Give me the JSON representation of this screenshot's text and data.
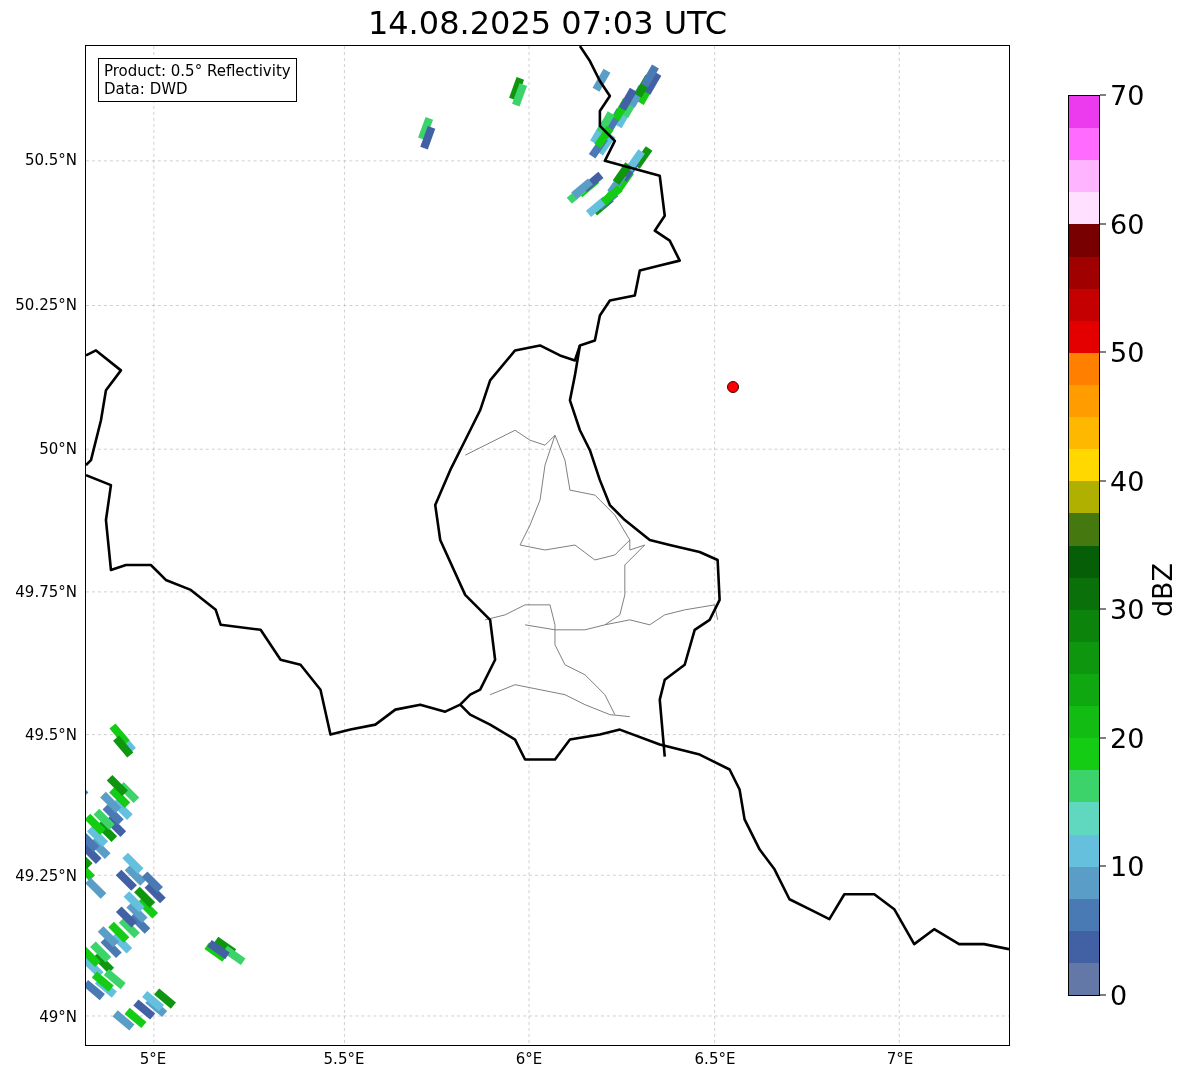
{
  "title": "14.08.2025 07:03 UTC",
  "legend": [
    "Product: 0.5° Reflectivity",
    "Data: DWD"
  ],
  "lat_ticks": [
    "50.5°N",
    "50.25°N",
    "50°N",
    "49.75°N",
    "49.5°N",
    "49.25°N",
    "49°N"
  ],
  "lon_ticks": [
    "5°E",
    "5.5°E",
    "6°E",
    "6.5°E",
    "7°E"
  ],
  "colorbar": {
    "label": "dBZ",
    "ticks": [
      "70",
      "60",
      "50",
      "40",
      "30",
      "20",
      "10",
      "0"
    ],
    "segments": [
      {
        "color": "#ec3aee"
      },
      {
        "color": "#ff6aff"
      },
      {
        "color": "#ffb4ff"
      },
      {
        "color": "#ffe0ff"
      },
      {
        "color": "#780000"
      },
      {
        "color": "#a00000"
      },
      {
        "color": "#c40000"
      },
      {
        "color": "#e40000"
      },
      {
        "color": "#ff7f00"
      },
      {
        "color": "#ff9c00"
      },
      {
        "color": "#ffb800"
      },
      {
        "color": "#ffd800"
      },
      {
        "color": "#b0b000"
      },
      {
        "color": "#467810"
      },
      {
        "color": "#065e06"
      },
      {
        "color": "#0a700a"
      },
      {
        "color": "#0c840c"
      },
      {
        "color": "#0e960e"
      },
      {
        "color": "#10a810"
      },
      {
        "color": "#12bc12"
      },
      {
        "color": "#14cc14"
      },
      {
        "color": "#3cd46a"
      },
      {
        "color": "#60d8c0"
      },
      {
        "color": "#64c0dc"
      },
      {
        "color": "#5a9ec8"
      },
      {
        "color": "#4a7ab4"
      },
      {
        "color": "#4260a4"
      },
      {
        "color": "#6478a8"
      }
    ]
  }
}
